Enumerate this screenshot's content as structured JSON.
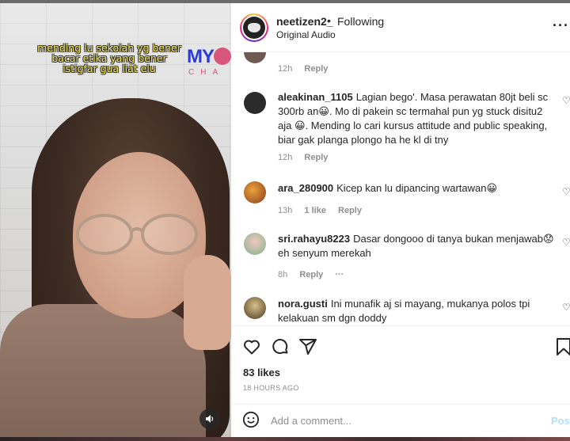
{
  "video": {
    "caption_lines": [
      "mending lu sekolah yg bener",
      "bacar etika yang bener",
      "istigfar gua liat elu"
    ],
    "brand_logo": "MY",
    "brand_sub": "CHA",
    "mute_icon": "speaker-icon"
  },
  "header": {
    "username": "neetizen2_",
    "separator": "•",
    "follow_status": "Following",
    "audio": "Original Audio",
    "more": "···"
  },
  "comments": [
    {
      "username": "",
      "text": "",
      "meta": {
        "time": "12h",
        "likes": "",
        "reply": "Reply"
      }
    },
    {
      "username": "aleakinan_1105",
      "text": "Lagian bego'. Masa perawatan 80jt beli sc 300rb an😀. Mo di pakein sc termahal pun yg stuck disitu2 aja 😀. Mending lo cari kursus attitude and public speaking, biar gak planga plongo ha he kl di tny",
      "meta": {
        "time": "12h",
        "likes": "",
        "reply": "Reply"
      }
    },
    {
      "username": "ara_280900",
      "text": "Kicep kan lu dipancing wartawan😀",
      "meta": {
        "time": "13h",
        "likes": "1 like",
        "reply": "Reply"
      }
    },
    {
      "username": "sri.rahayu8223",
      "text": "Dasar dongooo di tanya bukan menjawab😟eh senyum merekah",
      "meta": {
        "time": "8h",
        "likes": "",
        "reply": "Reply",
        "more": "···"
      }
    },
    {
      "username": "nora.gusti",
      "text": "Ini munafik aj si mayang, mukanya polos tpi kelakuan sm dgn doddy",
      "meta": {
        "time": "",
        "likes": "",
        "reply": ""
      }
    }
  ],
  "actions": {
    "likes": "83 likes",
    "time_ago": "18 HOURS AGO"
  },
  "comment_box": {
    "placeholder": "Add a comment...",
    "post": "Post"
  },
  "colors": {
    "caption_yellow": "#f1e35a",
    "brand_blue": "#2a3bd6",
    "brand_pink": "#d8567c",
    "post_disabled": "#b2dffc",
    "meta_gray": "#8e8e8e"
  }
}
